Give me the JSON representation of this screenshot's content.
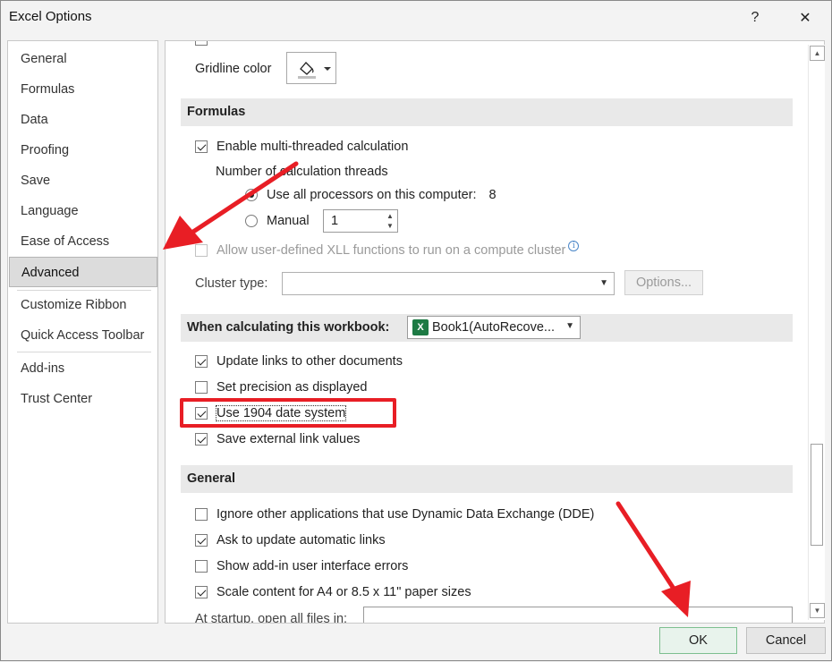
{
  "window": {
    "title": "Excel Options",
    "help_glyph": "?",
    "close_glyph": "✕"
  },
  "nav": {
    "items": [
      {
        "label": "General"
      },
      {
        "label": "Formulas"
      },
      {
        "label": "Data"
      },
      {
        "label": "Proofing"
      },
      {
        "label": "Save"
      },
      {
        "label": "Language"
      },
      {
        "label": "Ease of Access"
      },
      {
        "label": "Advanced",
        "selected": true
      },
      {
        "label": "Customize Ribbon"
      },
      {
        "label": "Quick Access Toolbar"
      },
      {
        "label": "Add-ins"
      },
      {
        "label": "Trust Center"
      }
    ]
  },
  "display": {
    "gridline_color_label": "Gridline color"
  },
  "formulas": {
    "heading": "Formulas",
    "multithreaded_label": "Enable multi-threaded calculation",
    "multithreaded_checked": true,
    "threads_label": "Number of calculation threads",
    "use_all_label": "Use all processors on this computer:",
    "processor_count": "8",
    "manual_label": "Manual",
    "manual_value": "1",
    "xll_label": "Allow user-defined XLL functions to run on a compute cluster",
    "info_glyph": "i",
    "cluster_type_label": "Cluster type:",
    "cluster_type_value": "",
    "options_button": "Options..."
  },
  "workbook": {
    "heading": "When calculating this workbook:",
    "selected_workbook": "Book1(AutoRecove...",
    "excel_glyph": "X",
    "options": [
      {
        "label": "Update links to other documents",
        "checked": true
      },
      {
        "label": "Set precision as displayed",
        "checked": false
      },
      {
        "label": "Use 1904 date system",
        "checked": true
      },
      {
        "label": "Save external link values",
        "checked": true
      }
    ]
  },
  "general": {
    "heading": "General",
    "options": [
      {
        "label": "Ignore other applications that use Dynamic Data Exchange (DDE)",
        "checked": false
      },
      {
        "label": "Ask to update automatic links",
        "checked": true
      },
      {
        "label": "Show add-in user interface errors",
        "checked": false
      },
      {
        "label": "Scale content for A4 or 8.5 x 11\" paper sizes",
        "checked": true
      }
    ],
    "startup_label": "At startup, open all files in:",
    "startup_value": ""
  },
  "footer": {
    "ok_label": "OK",
    "cancel_label": "Cancel"
  },
  "colors": {
    "annotation_red": "#e81e25",
    "ok_border": "#7dbf8f",
    "excel_green": "#1d7a44"
  }
}
